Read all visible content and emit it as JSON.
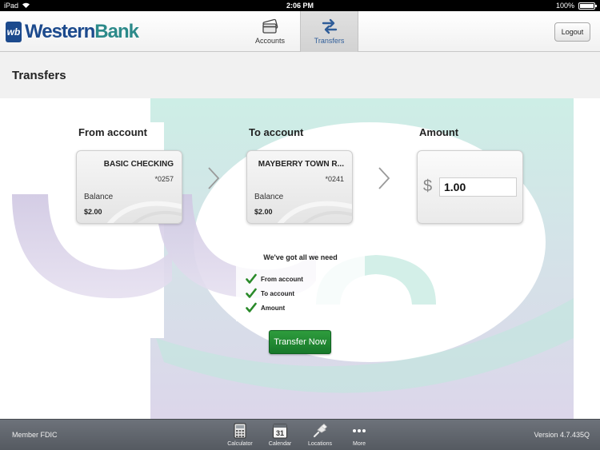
{
  "status_bar": {
    "carrier": "iPad",
    "time": "2:06 PM",
    "battery": "100%"
  },
  "header": {
    "logo_prefix": "Western",
    "logo_suffix": "Bank",
    "logo_mark": "wb",
    "tabs": [
      {
        "label": "Accounts",
        "icon": "cards-icon",
        "selected": false
      },
      {
        "label": "Transfers",
        "icon": "transfer-arrows-icon",
        "selected": true
      }
    ],
    "logout_label": "Logout"
  },
  "page": {
    "title": "Transfers"
  },
  "transfer": {
    "from": {
      "label": "From account",
      "name": "BASIC CHECKING",
      "number": "*0257",
      "balance_label": "Balance",
      "balance": "$2.00"
    },
    "to": {
      "label": "To account",
      "name": "MAYBERRY TOWN R...",
      "number": "*0241",
      "balance_label": "Balance",
      "balance": "$2.00"
    },
    "amount": {
      "label": "Amount",
      "currency": "$",
      "value": "1.00"
    },
    "checklist": {
      "title": "We've got all we need",
      "items": [
        "From account",
        "To account",
        "Amount"
      ]
    },
    "submit_label": "Transfer Now"
  },
  "footer": {
    "left": "Member FDIC",
    "items": [
      {
        "label": "Calculator",
        "icon": "calculator-icon"
      },
      {
        "label": "Calendar",
        "icon": "calendar-icon",
        "day": "31"
      },
      {
        "label": "Locations",
        "icon": "map-pin-icon"
      },
      {
        "label": "More",
        "icon": "more-dots-icon"
      }
    ],
    "version": "Version 4.7.435Q"
  },
  "colors": {
    "brand_blue": "#1c4a8d",
    "brand_teal": "#2c8a8a",
    "tab_selected_text": "#2f5d99",
    "button_green": "#1f8a33",
    "check_green": "#2a8a2a",
    "footer_bg": "#5f646b"
  }
}
